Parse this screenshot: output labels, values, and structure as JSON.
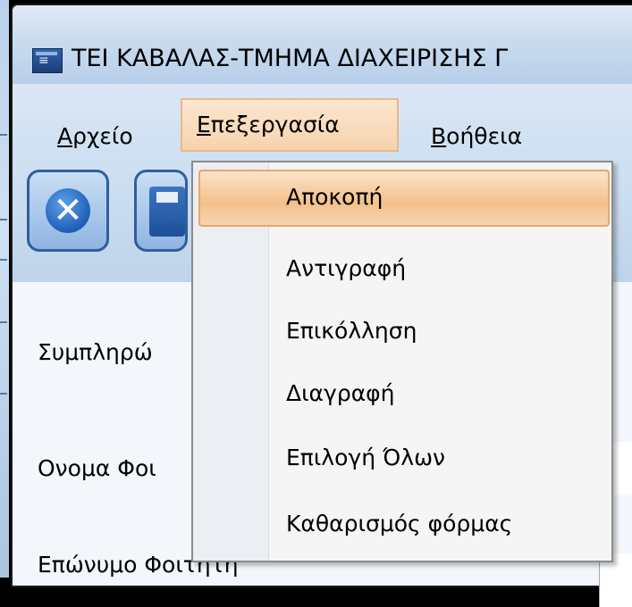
{
  "window": {
    "title": "ΤΕΙ ΚΑΒΑΛΑΣ-ΤΜΗΜΑ ΔΙΑΧΕΙΡΙΣΗΣ Γ"
  },
  "menubar": {
    "items": [
      {
        "label": "Αρχείο",
        "accel": "Α"
      },
      {
        "label": "Επεξεργασία",
        "accel": "Ε",
        "open": true
      },
      {
        "label": "Βοήθεια",
        "accel": "Β"
      }
    ]
  },
  "toolbar": {
    "buttons": [
      {
        "icon": "close-x-icon"
      },
      {
        "icon": "save-disk-icon"
      }
    ]
  },
  "form": {
    "labels": [
      "Συμπληρώ",
      "Ονομα Φοι",
      "Επώνυμο Φοιτητή"
    ]
  },
  "edit_menu": {
    "items": [
      {
        "label": "Αποκοπή",
        "highlighted": true
      },
      {
        "label": "Αντιγραφή"
      },
      {
        "label": "Επικόλληση"
      },
      {
        "label": "Διαγραφή"
      },
      {
        "label": "Επιλογή Όλων"
      },
      {
        "label": "Καθαρισμός φόρμας"
      }
    ]
  },
  "colors": {
    "highlight": "#f3c08d",
    "highlight_border": "#e7a76a",
    "chrome": "#c9dbef"
  }
}
